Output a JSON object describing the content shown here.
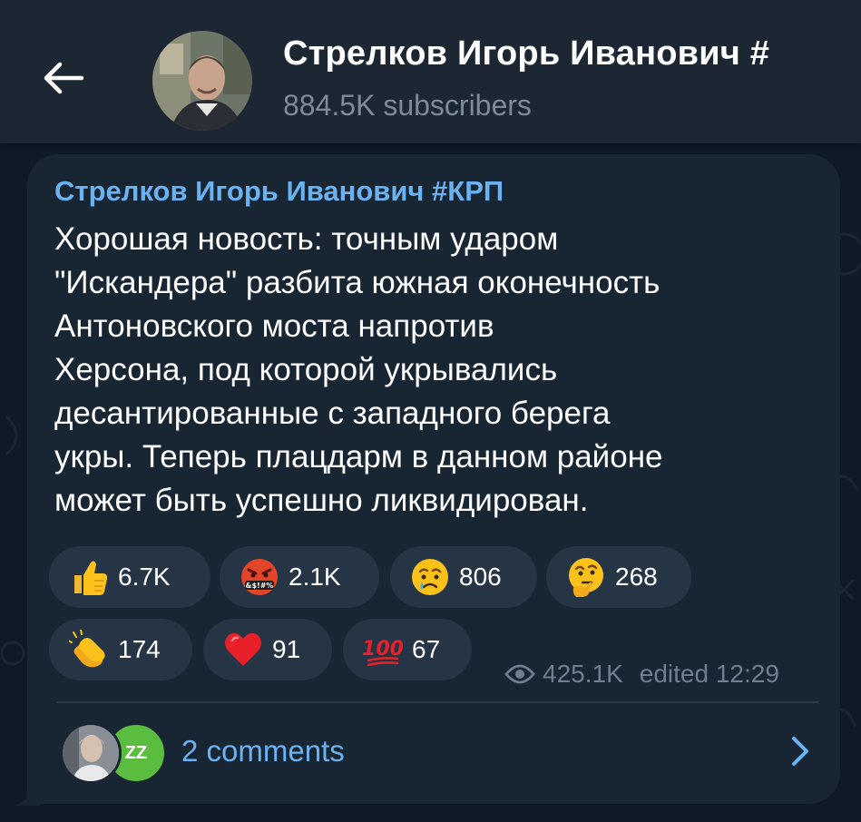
{
  "header": {
    "title": "Стрелков Игорь Иванович #",
    "subscribers": "884.5K subscribers",
    "back_icon": "back-arrow-icon",
    "avatar_icon": "channel-avatar"
  },
  "message": {
    "author": "Стрелков Игорь Иванович #КРП",
    "lines": [
      "Хорошая новость: точным ударом",
      "\"Искандера\" разбита южная оконечность",
      "Антоновского моста напротив",
      "Херсона, под которой укрывались",
      "десантированные с западного берега",
      "укры. Теперь плацдарм в данном районе",
      "может быть успешно ликвидирован."
    ],
    "reactions": [
      {
        "icon": "thumbs-up-icon",
        "count": "6.7K"
      },
      {
        "icon": "cursing-face-icon",
        "count": "2.1K"
      },
      {
        "icon": "crying-face-icon",
        "count": "806"
      },
      {
        "icon": "thinking-face-icon",
        "count": "268"
      },
      {
        "icon": "clapping-hands-icon",
        "count": "174"
      },
      {
        "icon": "red-heart-icon",
        "count": "91"
      },
      {
        "icon": "hundred-points-icon",
        "count": "67"
      }
    ],
    "views": "425.1K",
    "edited": "edited 12:29",
    "comments_label": "2 comments",
    "commenter_initials": "ZZ"
  },
  "colors": {
    "header_bg": "#1d2733",
    "bubble_bg": "#182533",
    "reaction_bg": "#263545",
    "link_blue": "#6ab2f2",
    "meta_gray": "#6d7f91"
  }
}
